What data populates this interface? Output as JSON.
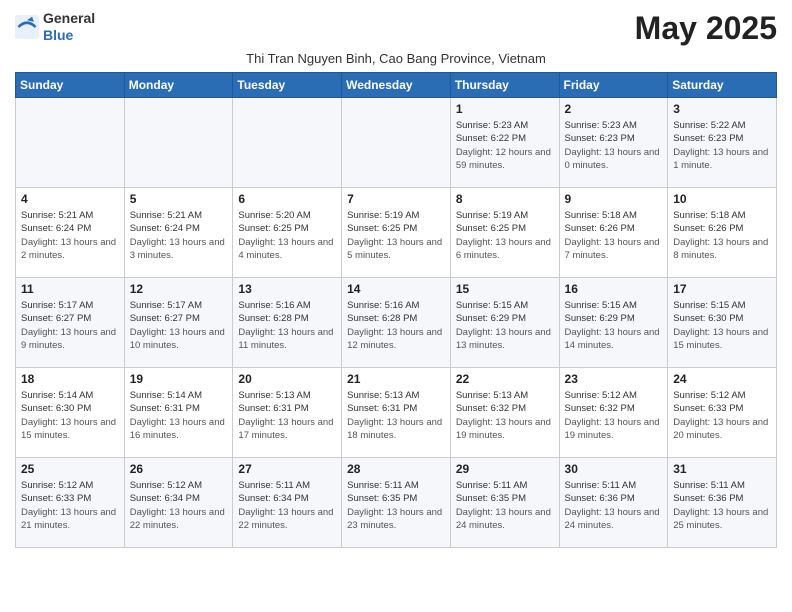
{
  "logo": {
    "general": "General",
    "blue": "Blue"
  },
  "header": {
    "month_title": "May 2025",
    "subtitle": "Thi Tran Nguyen Binh, Cao Bang Province, Vietnam"
  },
  "weekdays": [
    "Sunday",
    "Monday",
    "Tuesday",
    "Wednesday",
    "Thursday",
    "Friday",
    "Saturday"
  ],
  "weeks": [
    [
      {
        "day": "",
        "info": ""
      },
      {
        "day": "",
        "info": ""
      },
      {
        "day": "",
        "info": ""
      },
      {
        "day": "",
        "info": ""
      },
      {
        "day": "1",
        "sunrise": "5:23 AM",
        "sunset": "6:22 PM",
        "daylight": "12 hours and 59 minutes."
      },
      {
        "day": "2",
        "sunrise": "5:23 AM",
        "sunset": "6:23 PM",
        "daylight": "13 hours and 0 minutes."
      },
      {
        "day": "3",
        "sunrise": "5:22 AM",
        "sunset": "6:23 PM",
        "daylight": "13 hours and 1 minute."
      }
    ],
    [
      {
        "day": "4",
        "sunrise": "5:21 AM",
        "sunset": "6:24 PM",
        "daylight": "13 hours and 2 minutes."
      },
      {
        "day": "5",
        "sunrise": "5:21 AM",
        "sunset": "6:24 PM",
        "daylight": "13 hours and 3 minutes."
      },
      {
        "day": "6",
        "sunrise": "5:20 AM",
        "sunset": "6:25 PM",
        "daylight": "13 hours and 4 minutes."
      },
      {
        "day": "7",
        "sunrise": "5:19 AM",
        "sunset": "6:25 PM",
        "daylight": "13 hours and 5 minutes."
      },
      {
        "day": "8",
        "sunrise": "5:19 AM",
        "sunset": "6:25 PM",
        "daylight": "13 hours and 6 minutes."
      },
      {
        "day": "9",
        "sunrise": "5:18 AM",
        "sunset": "6:26 PM",
        "daylight": "13 hours and 7 minutes."
      },
      {
        "day": "10",
        "sunrise": "5:18 AM",
        "sunset": "6:26 PM",
        "daylight": "13 hours and 8 minutes."
      }
    ],
    [
      {
        "day": "11",
        "sunrise": "5:17 AM",
        "sunset": "6:27 PM",
        "daylight": "13 hours and 9 minutes."
      },
      {
        "day": "12",
        "sunrise": "5:17 AM",
        "sunset": "6:27 PM",
        "daylight": "13 hours and 10 minutes."
      },
      {
        "day": "13",
        "sunrise": "5:16 AM",
        "sunset": "6:28 PM",
        "daylight": "13 hours and 11 minutes."
      },
      {
        "day": "14",
        "sunrise": "5:16 AM",
        "sunset": "6:28 PM",
        "daylight": "13 hours and 12 minutes."
      },
      {
        "day": "15",
        "sunrise": "5:15 AM",
        "sunset": "6:29 PM",
        "daylight": "13 hours and 13 minutes."
      },
      {
        "day": "16",
        "sunrise": "5:15 AM",
        "sunset": "6:29 PM",
        "daylight": "13 hours and 14 minutes."
      },
      {
        "day": "17",
        "sunrise": "5:15 AM",
        "sunset": "6:30 PM",
        "daylight": "13 hours and 15 minutes."
      }
    ],
    [
      {
        "day": "18",
        "sunrise": "5:14 AM",
        "sunset": "6:30 PM",
        "daylight": "13 hours and 15 minutes."
      },
      {
        "day": "19",
        "sunrise": "5:14 AM",
        "sunset": "6:31 PM",
        "daylight": "13 hours and 16 minutes."
      },
      {
        "day": "20",
        "sunrise": "5:13 AM",
        "sunset": "6:31 PM",
        "daylight": "13 hours and 17 minutes."
      },
      {
        "day": "21",
        "sunrise": "5:13 AM",
        "sunset": "6:31 PM",
        "daylight": "13 hours and 18 minutes."
      },
      {
        "day": "22",
        "sunrise": "5:13 AM",
        "sunset": "6:32 PM",
        "daylight": "13 hours and 19 minutes."
      },
      {
        "day": "23",
        "sunrise": "5:12 AM",
        "sunset": "6:32 PM",
        "daylight": "13 hours and 19 minutes."
      },
      {
        "day": "24",
        "sunrise": "5:12 AM",
        "sunset": "6:33 PM",
        "daylight": "13 hours and 20 minutes."
      }
    ],
    [
      {
        "day": "25",
        "sunrise": "5:12 AM",
        "sunset": "6:33 PM",
        "daylight": "13 hours and 21 minutes."
      },
      {
        "day": "26",
        "sunrise": "5:12 AM",
        "sunset": "6:34 PM",
        "daylight": "13 hours and 22 minutes."
      },
      {
        "day": "27",
        "sunrise": "5:11 AM",
        "sunset": "6:34 PM",
        "daylight": "13 hours and 22 minutes."
      },
      {
        "day": "28",
        "sunrise": "5:11 AM",
        "sunset": "6:35 PM",
        "daylight": "13 hours and 23 minutes."
      },
      {
        "day": "29",
        "sunrise": "5:11 AM",
        "sunset": "6:35 PM",
        "daylight": "13 hours and 24 minutes."
      },
      {
        "day": "30",
        "sunrise": "5:11 AM",
        "sunset": "6:36 PM",
        "daylight": "13 hours and 24 minutes."
      },
      {
        "day": "31",
        "sunrise": "5:11 AM",
        "sunset": "6:36 PM",
        "daylight": "13 hours and 25 minutes."
      }
    ]
  ]
}
